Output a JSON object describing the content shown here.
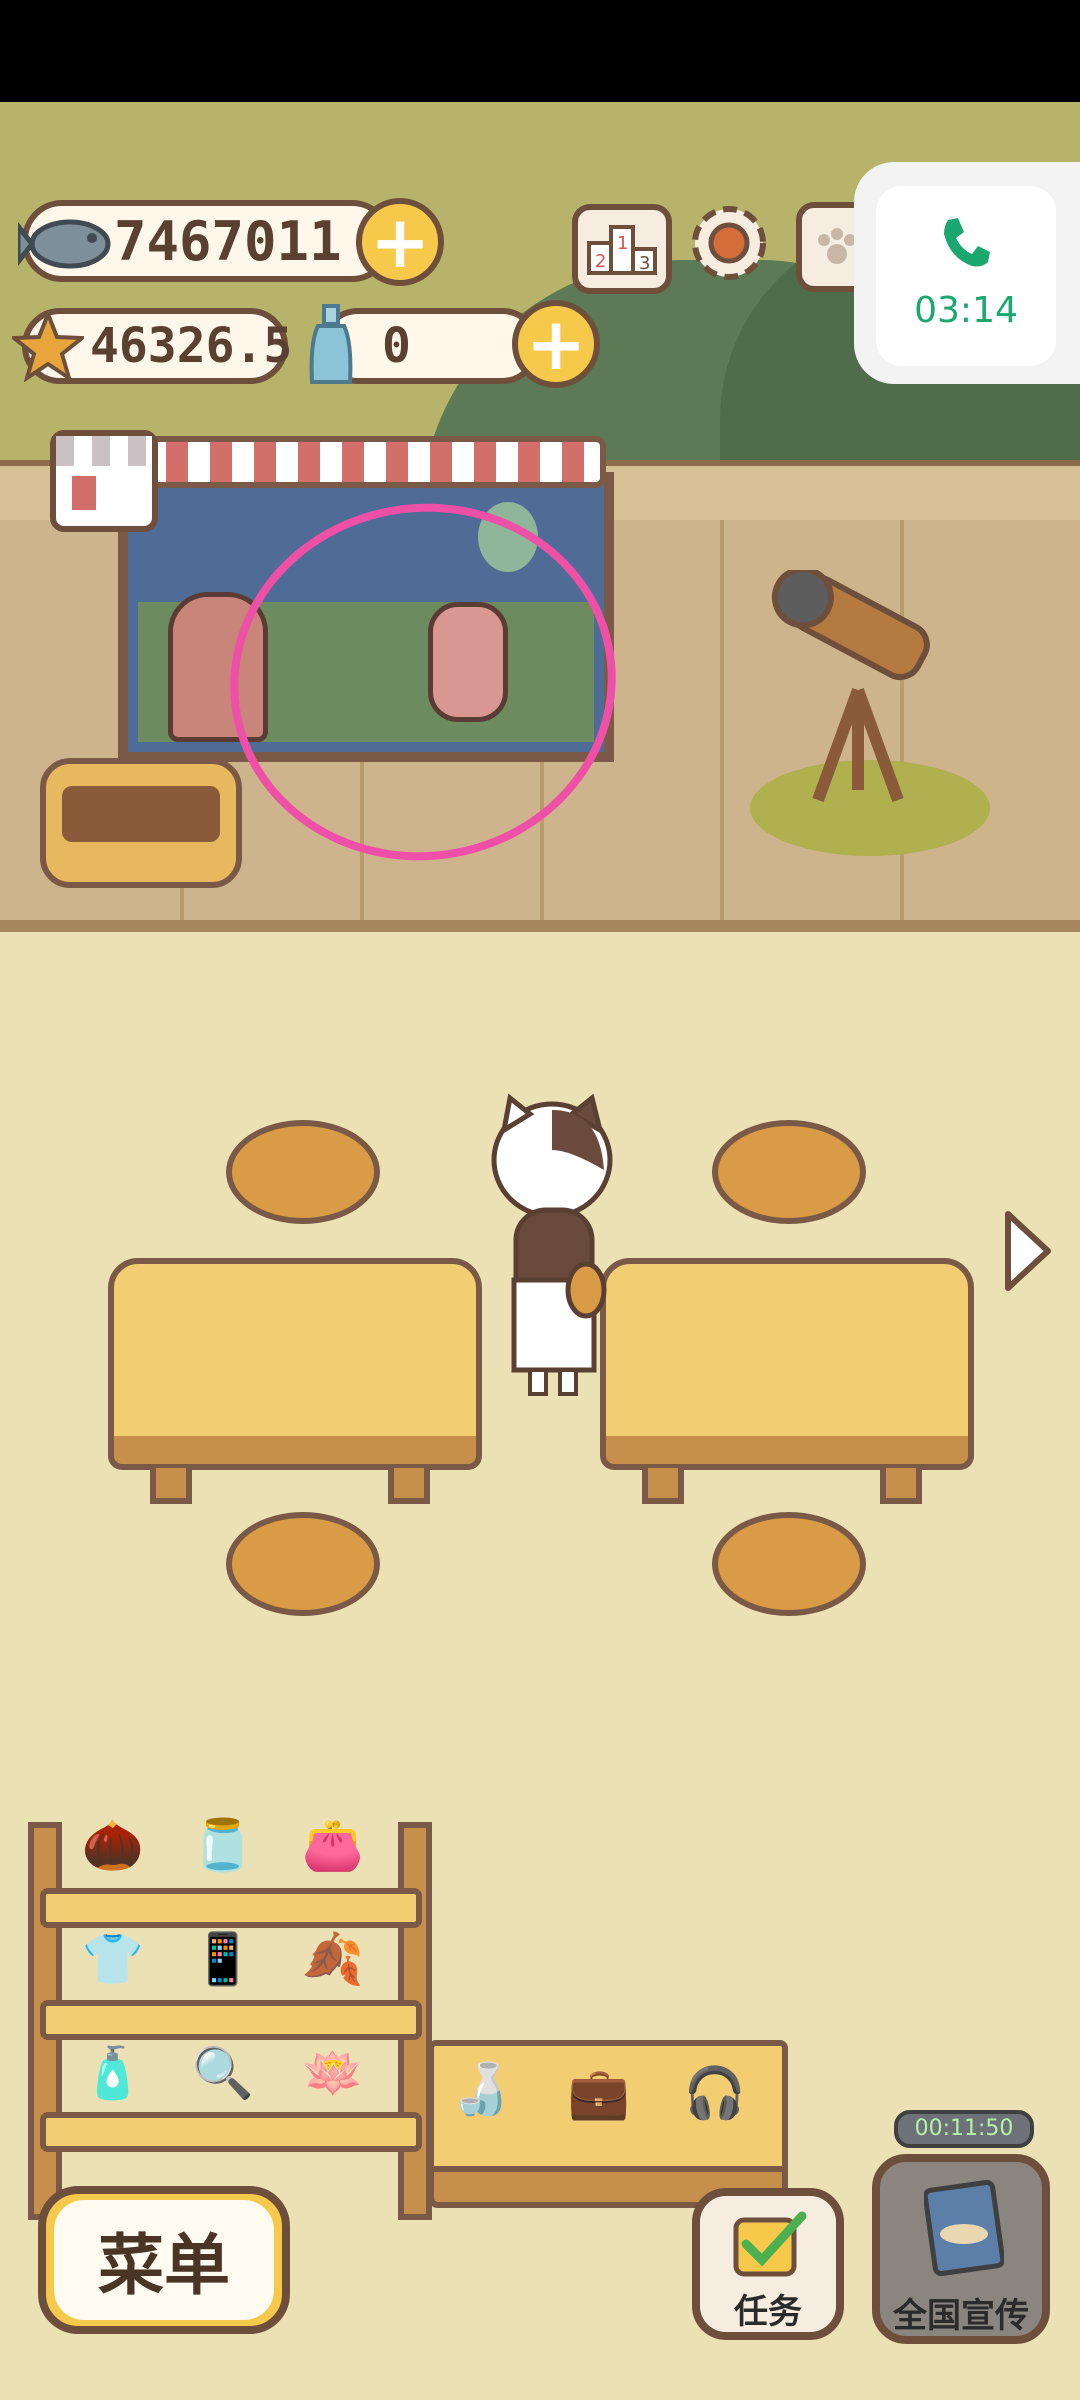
{
  "currencies": {
    "fish": {
      "icon": "fish-icon",
      "value": "7467011"
    },
    "stars": {
      "icon": "star-icon",
      "value": "46326.5"
    },
    "bottles": {
      "icon": "bottle-icon",
      "value": "0"
    }
  },
  "top_buttons": [
    "leaderboard-icon",
    "settings-gear-icon",
    "paw-book-icon"
  ],
  "call": {
    "icon": "phone-icon",
    "time": "03:14",
    "color": "#1aa870"
  },
  "annotation": {
    "color": "#ee4fa7"
  },
  "bottom": {
    "menu_label": "菜单",
    "task_label": "任务",
    "promo_label": "全国宣传",
    "promo_timer": "00:11:50"
  },
  "colors": {
    "accent_yellow": "#f7c94b",
    "outline_brown": "#6e4f3c"
  }
}
